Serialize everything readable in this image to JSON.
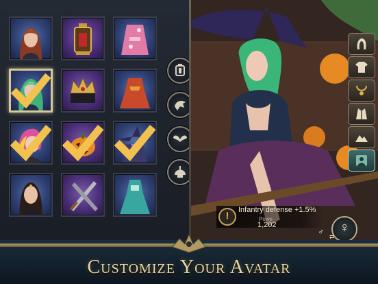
{
  "avatar_grid": {
    "tiles": [
      {
        "name": "portrait-redhead",
        "bg": "blue",
        "selected": false,
        "equipped": false
      },
      {
        "name": "lantern-frame",
        "bg": "purple",
        "selected": false,
        "equipped": false
      },
      {
        "name": "pink-kimono-outfit",
        "bg": "blue",
        "selected": false,
        "equipped": false
      },
      {
        "name": "portrait-green-hair",
        "bg": "blue",
        "selected": true,
        "equipped": true
      },
      {
        "name": "crown-frame",
        "bg": "purple",
        "selected": false,
        "equipped": false
      },
      {
        "name": "red-dress-outfit",
        "bg": "blue",
        "selected": false,
        "equipped": false
      },
      {
        "name": "portrait-pink-hair",
        "bg": "blue",
        "selected": false,
        "equipped": true
      },
      {
        "name": "pumpkin-frame",
        "bg": "purple",
        "selected": false,
        "equipped": true
      },
      {
        "name": "witch-outfit",
        "bg": "blue",
        "selected": false,
        "equipped": true
      },
      {
        "name": "portrait-dark-hair",
        "bg": "blue",
        "selected": false,
        "equipped": false
      },
      {
        "name": "swords-frame",
        "bg": "purple",
        "selected": false,
        "equipped": false
      },
      {
        "name": "teal-gown-outfit",
        "bg": "blue",
        "selected": false,
        "equipped": false
      }
    ]
  },
  "side_buttons": [
    "lantern-icon",
    "eagle-icon",
    "wings-icon",
    "helmet-icon"
  ],
  "right_buttons": [
    {
      "icon": "hair-icon",
      "active": false
    },
    {
      "icon": "shirt-icon",
      "active": false
    },
    {
      "icon": "necklace-icon",
      "active": false
    },
    {
      "icon": "jacket-icon",
      "active": false
    },
    {
      "icon": "landscape-icon",
      "active": false
    },
    {
      "icon": "portrait-icon",
      "active": true
    }
  ],
  "buff": {
    "icon_glyph": "!",
    "text": "Infantry defense +1.5%"
  },
  "power": {
    "label": "Powe",
    "value": "1,202"
  },
  "gender": {
    "female_glyph": "♀",
    "male_glyph": "♂",
    "swap_glyph": "⇄"
  },
  "banner": {
    "title": "Customize Your Avatar"
  },
  "colors": {
    "accent_gold": "#e6d7a8",
    "check_gold": "#f2c14e",
    "selected_border": "#d8c79a"
  }
}
